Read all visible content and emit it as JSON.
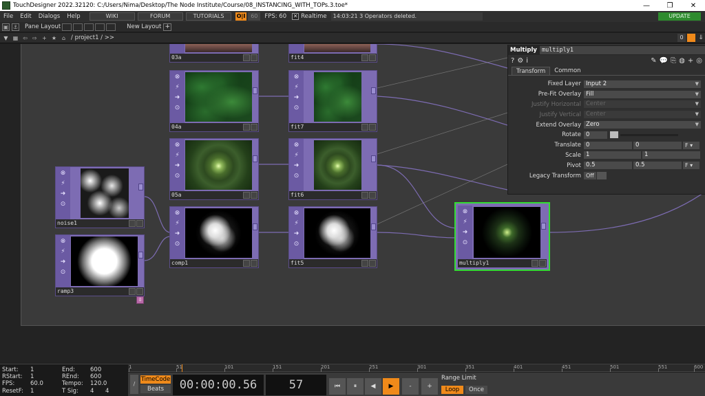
{
  "title_bar": {
    "title": "TouchDesigner 2022.32120: C:/Users/Nima/Desktop/The Node Institute/Course/08_INSTANCING_WITH_TOPs.3.toe*",
    "minimize": "—",
    "maximize": "❐",
    "close": "✕"
  },
  "menu": {
    "items": [
      "File",
      "Edit",
      "Dialogs",
      "Help"
    ],
    "wiki": "WIKI",
    "forum": "FORUM",
    "tutorials": "TUTORIALS",
    "perf_badge": "O|I",
    "cook_rate": "60",
    "fps_label": "FPS:  60",
    "realtime_check": "✕",
    "realtime_label": "Realtime",
    "status": "14:03:21 3 Operators deleted.",
    "update": "UPDATE"
  },
  "pane_bar": {
    "pane_layout": "Pane Layout",
    "new_layout": "New Layout",
    "plus": "+"
  },
  "path_bar": {
    "path": "/ project1 / >>",
    "zero": "0"
  },
  "nodes": [
    {
      "name": "03a",
      "id": "03a"
    },
    {
      "name": "fit4",
      "id": "fit4"
    },
    {
      "name": "04a",
      "id": "04a"
    },
    {
      "name": "fit7",
      "id": "fit7"
    },
    {
      "name": "05a",
      "id": "05a"
    },
    {
      "name": "fit6",
      "id": "fit6"
    },
    {
      "name": "noise1",
      "id": "noise1"
    },
    {
      "name": "comp1",
      "id": "comp1"
    },
    {
      "name": "fit5",
      "id": "fit5"
    },
    {
      "name": "ramp3",
      "id": "ramp3"
    },
    {
      "name": "multiply1",
      "id": "multiply1"
    }
  ],
  "params": {
    "op_type": "Multiply",
    "op_name": "multiply1",
    "tabs": [
      "Transform",
      "Common"
    ],
    "fixed_layer": {
      "label": "Fixed Layer",
      "value": "Input 2"
    },
    "pre_fit_overlay": {
      "label": "Pre-Fit Overlay",
      "value": "Fill"
    },
    "justify_horizontal": {
      "label": "Justify Horizontal",
      "value": "Center"
    },
    "justify_vertical": {
      "label": "Justify Vertical",
      "value": "Center"
    },
    "extend_overlay": {
      "label": "Extend Overlay",
      "value": "Zero"
    },
    "rotate": {
      "label": "Rotate",
      "value": "0"
    },
    "translate": {
      "label": "Translate",
      "x": "0",
      "y": "0",
      "unit": "F"
    },
    "scale": {
      "label": "Scale",
      "x": "1",
      "y": "1"
    },
    "pivot": {
      "label": "Pivot",
      "x": "0.5",
      "y": "0.5",
      "unit": "F"
    },
    "legacy_transform": {
      "label": "Legacy Transform",
      "value": "Off"
    }
  },
  "timeline": {
    "start_label": "Start:",
    "start": "1",
    "end_label": "End:",
    "end": "600",
    "rstart_label": "RStart:",
    "rstart": "1",
    "rend_label": "REnd:",
    "rend": "600",
    "fps_label": "FPS:",
    "fps": "60.0",
    "tempo_label": "Tempo:",
    "tempo": "120.0",
    "resetf_label": "ResetF:",
    "resetf": "1",
    "tsig_label": "T Sig:",
    "tsig_a": "4",
    "tsig_b": "4",
    "ticks": [
      "1",
      "51",
      "101",
      "151",
      "201",
      "251",
      "301",
      "351",
      "401",
      "451",
      "501",
      "551",
      "600"
    ],
    "timecode_btn": "TimeCode",
    "beats_btn": "Beats",
    "timecode": "00:00:00.56",
    "frame": "57",
    "range_limit": "Range Limit",
    "loop": "Loop",
    "once": "Once",
    "transport": [
      "⏮",
      "⏸",
      "◀",
      "▶",
      "-",
      "+"
    ]
  }
}
